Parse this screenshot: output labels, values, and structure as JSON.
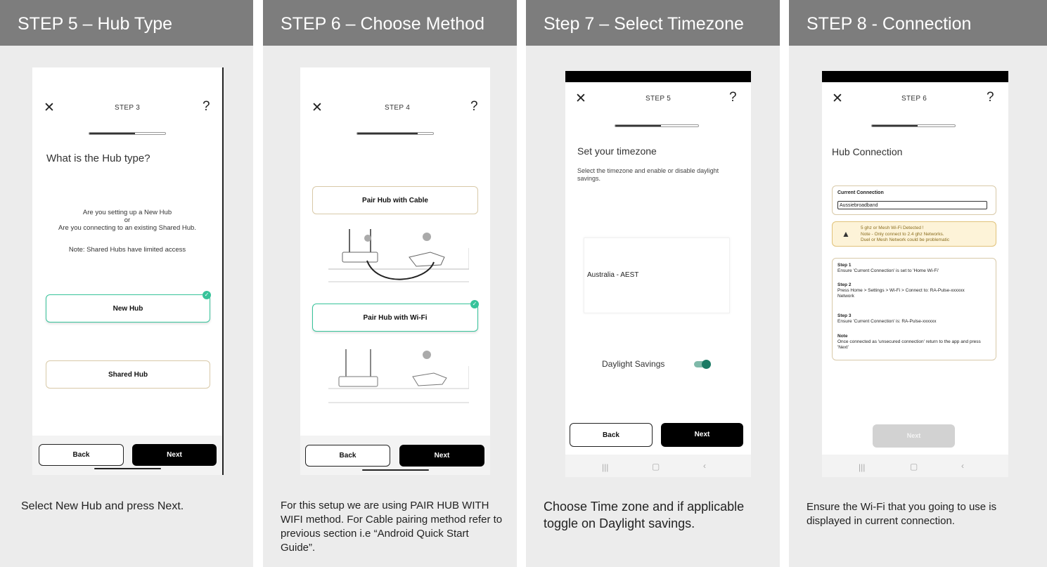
{
  "columns": [
    {
      "header": "STEP 5 – Hub Type",
      "caption": "Select New Hub and press Next.",
      "phone": {
        "step": "STEP 3",
        "title": "What is the Hub type?",
        "question_lines": [
          "Are you setting up a New Hub",
          "or",
          "Are you connecting to an existing Shared Hub."
        ],
        "note": "Note: Shared Hubs have limited access",
        "options": [
          "New Hub",
          "Shared Hub"
        ],
        "selected": "New Hub",
        "back_label": "Back",
        "next_label": "Next",
        "progress": 0.6
      }
    },
    {
      "header": "STEP 6 – Choose Method",
      "caption": "For this setup we are using PAIR HUB WITH WIFI method. For Cable pairing method refer to previous section i.e “Android Quick Start Guide”.",
      "phone": {
        "step": "STEP 4",
        "options": [
          "Pair Hub with Cable",
          "Pair Hub with Wi-Fi"
        ],
        "selected": "Pair Hub with Wi-Fi",
        "back_label": "Back",
        "next_label": "Next",
        "progress": 0.8
      }
    },
    {
      "header": "Step 7 – Select Timezone",
      "caption": "Choose Time zone and if applicable toggle on Daylight savings.",
      "phone": {
        "step": "STEP 5",
        "title": "Set your timezone",
        "description": "Select the timezone and enable or disable daylight savings.",
        "timezone": "Australia - AEST",
        "daylight_label": "Daylight Savings",
        "daylight_on": true,
        "back_label": "Back",
        "next_label": "Next",
        "progress": 0.55
      }
    },
    {
      "header": "STEP 8 - Connection",
      "caption": "Ensure the Wi-Fi that you going to use is displayed in current connection.",
      "phone": {
        "step": "STEP 6",
        "title": "Hub Connection",
        "current_connection_label": "Current Connection",
        "current_connection_value": "Aussiebroadband",
        "warning_lines": [
          "5 ghz or Mesh Wi-Fi Detected !",
          "Note - Only connect to 2.4 ghz Networks.",
          "Duel or Mesh Network could be problematic"
        ],
        "steps": [
          {
            "title": "Step 1",
            "text": "Ensure 'Current Connection' is set to 'Home Wi-Fi'"
          },
          {
            "title": "Step 2",
            "text": "Press Home > Settings > Wi-Fi > Connect to: RA-Pulse-xxxxxx Network"
          },
          {
            "title": "Step 3",
            "text": "Ensure 'Current Connection' is: RA-Pulse-xxxxxx"
          },
          {
            "title": "Note",
            "text": "Once connected as 'unsecured connection' return to the app and press 'Next'"
          }
        ],
        "next_label": "Next",
        "progress": 0.55
      }
    }
  ],
  "colors": {
    "header_bg": "#7d7d7d",
    "panel_bg": "#ececec",
    "accent_green": "#37c39a",
    "toggle_green": "#1a7a64"
  }
}
